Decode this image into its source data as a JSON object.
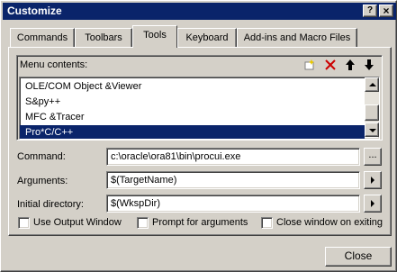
{
  "window": {
    "title": "Customize",
    "help_btn": "?",
    "close_btn": "×"
  },
  "tabs": [
    {
      "label": "Commands",
      "active": false
    },
    {
      "label": "Toolbars",
      "active": false
    },
    {
      "label": "Tools",
      "active": true
    },
    {
      "label": "Keyboard",
      "active": false
    },
    {
      "label": "Add-ins and Macro Files",
      "active": false
    }
  ],
  "menu": {
    "header": "Menu contents:",
    "items": [
      {
        "label": "OLE/COM Object &Viewer",
        "selected": false
      },
      {
        "label": "S&py++",
        "selected": false
      },
      {
        "label": "MFC &Tracer",
        "selected": false
      },
      {
        "label": "Pro*C/C++",
        "selected": true
      }
    ],
    "toolbar_icons": [
      "new-item-icon",
      "delete-icon",
      "move-up-icon",
      "move-down-icon"
    ]
  },
  "fields": {
    "command_label": "Command:",
    "command_value": "c:\\oracle\\ora81\\bin\\procui.exe",
    "browse_label": "...",
    "arguments_label": "Arguments:",
    "arguments_value": "$(TargetName)",
    "initial_dir_label": "Initial directory:",
    "initial_dir_value": "$(WkspDir)"
  },
  "checkboxes": [
    {
      "label": "Use Output Window",
      "checked": false
    },
    {
      "label": "Prompt for arguments",
      "checked": false
    },
    {
      "label": "Close window on exiting",
      "checked": false
    }
  ],
  "buttons": {
    "close": "Close"
  },
  "colors": {
    "face": "#d4d0c8",
    "titlebar": "#0a246a",
    "selection": "#0a246a",
    "delete_red": "#cc0000"
  }
}
